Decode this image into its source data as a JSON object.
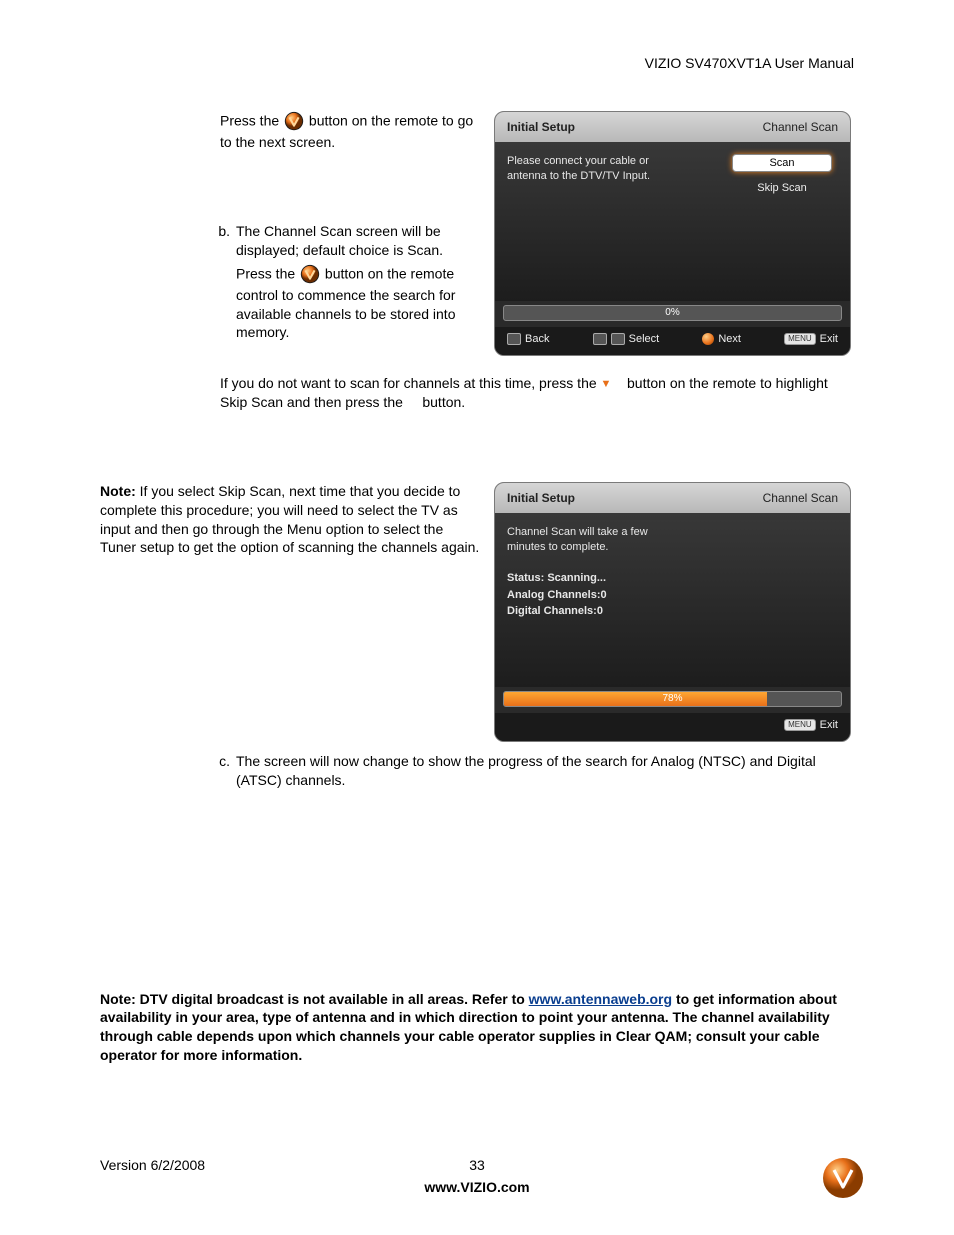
{
  "header": {
    "title": "VIZIO SV470XVT1A User Manual"
  },
  "section_a": {
    "line1_pre": "Press the ",
    "line1_post": " button on the remote to go to the next screen."
  },
  "section_b": {
    "marker": "b.",
    "para1": "The Channel Scan screen will be displayed; default choice is Scan.",
    "para2_pre": "Press the ",
    "para2_post": " button on the remote control to commence the search for available channels to be stored into memory.",
    "para3_pre": "If you do not want to scan for channels at this time, press the ",
    "para3_mid": " button on the remote to highlight Skip Scan and then press the ",
    "para3_post": " button."
  },
  "note1": {
    "label": "Note:",
    "text": " If you select Skip Scan, next time that you decide to complete this procedure; you will need to select the TV as input and then go through the Menu option to select the Tuner setup to get the option of scanning the channels again."
  },
  "section_c": {
    "marker": "c.",
    "text": "The screen will now change to show the progress of the search for Analog (NTSC) and Digital (ATSC) channels."
  },
  "note2": {
    "pre": "Note: DTV digital broadcast is not available in all areas.  Refer to ",
    "link": "www.antennaweb.org",
    "post": " to get information about availability in your area, type of antenna and in which direction to point your antenna.  The channel availability through cable depends upon which channels your cable operator supplies in Clear QAM; consult your cable operator for more information."
  },
  "osd1": {
    "title_left": "Initial Setup",
    "title_right": "Channel Scan",
    "msg_l1": "Please connect your cable or",
    "msg_l2": "antenna to the DTV/TV Input.",
    "scan_label": "Scan",
    "skip_label": "Skip Scan",
    "progress_pct": "0%",
    "footer": {
      "back": "Back",
      "select": "Select",
      "next": "Next",
      "exit": "Exit",
      "menu": "MENU"
    }
  },
  "osd2": {
    "title_left": "Initial Setup",
    "title_right": "Channel Scan",
    "msg_l1": "Channel Scan will take a few",
    "msg_l2": "minutes to complete.",
    "status_label": "Status: Scanning...",
    "analog_label": "Analog Channels:0",
    "digital_label": "Digital Channels:0",
    "progress_pct": "78%",
    "footer": {
      "exit": "Exit",
      "menu": "MENU"
    }
  },
  "footer": {
    "version": "Version 6/2/2008",
    "page": "33",
    "url": "www.VIZIO.com"
  }
}
